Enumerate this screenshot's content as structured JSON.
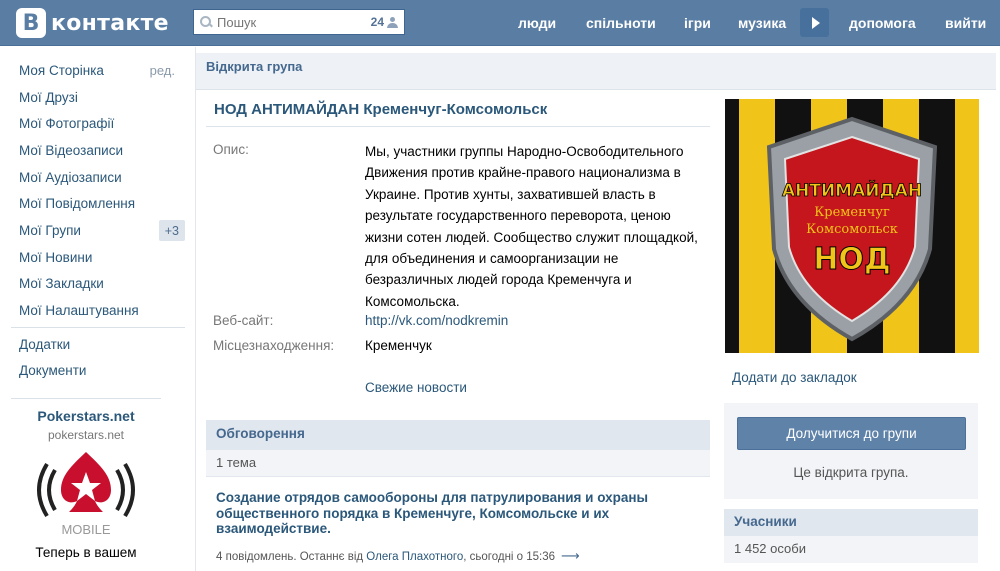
{
  "header": {
    "logo_letter": "В",
    "logo_text": "контакте",
    "search_placeholder": "Пошук",
    "search_count": "24",
    "nav": [
      "люди",
      "спільноти",
      "ігри",
      "музика",
      "допомога",
      "вийти"
    ]
  },
  "colors": {
    "header_bg": "#597da3",
    "link": "#2b587a",
    "button": "#5f82a9"
  },
  "sidebar": {
    "items": [
      {
        "label": "Моя Сторінка",
        "extra": "ред."
      },
      {
        "label": "Мої Друзі"
      },
      {
        "label": "Мої Фотографії"
      },
      {
        "label": "Мої Відеозаписи"
      },
      {
        "label": "Мої Аудіозаписи"
      },
      {
        "label": "Мої Повідомлення"
      },
      {
        "label": "Мої Групи",
        "badge": "+3"
      },
      {
        "label": "Мої Новини"
      },
      {
        "label": "Мої Закладки"
      },
      {
        "label": "Мої Налаштування"
      }
    ],
    "extras": [
      "Додатки",
      "Документи"
    ]
  },
  "ad": {
    "title": "Pokerstars.net",
    "url": "pokerstars.net",
    "image_text": "MOBILE",
    "text": "Теперь в вашем"
  },
  "group": {
    "type_label": "Відкрита група",
    "name": "НОД АНТИМАЙДАН Кременчуг-Комсомольск",
    "desc_label": "Опис:",
    "description": "Мы, участники группы Народно-Освободительного Движения против крайне-правого национализма в Украине. Против хунты, захватившей власть в результате государственного переворота, ценою жизни сотен людей. Сообщество служит площадкой, для объединения и самоорганизации не безразличных людей города Кременчуга и Комсомольска.",
    "website_label": "Веб-сайт:",
    "website": "http://vk.com/nodkremin",
    "location_label": "Місцезнаходження:",
    "location": "Кременчук",
    "news_link": "Свежие новости",
    "avatar_lines": [
      "АНТИМАЙДАН",
      "Кременчуг",
      "Комсомольск",
      "НОД"
    ]
  },
  "discussions": {
    "title": "Обговорення",
    "count": "1 тема",
    "topic_title": "Создание отрядов самообороны для патрулирования и охраны общественного порядка в Кременчуге, Комсомольске и их взаимодействие.",
    "meta_prefix": "4 повідомлень. Останнє від ",
    "meta_author": "Олега Плахотного",
    "meta_time": ", сьогодні о 15:36"
  },
  "side": {
    "bookmark": "Додати до закладок",
    "join": "Долучитися до групи",
    "join_note": "Це відкрита група.",
    "members_title": "Учасники",
    "members_count": "1 452 особи"
  }
}
